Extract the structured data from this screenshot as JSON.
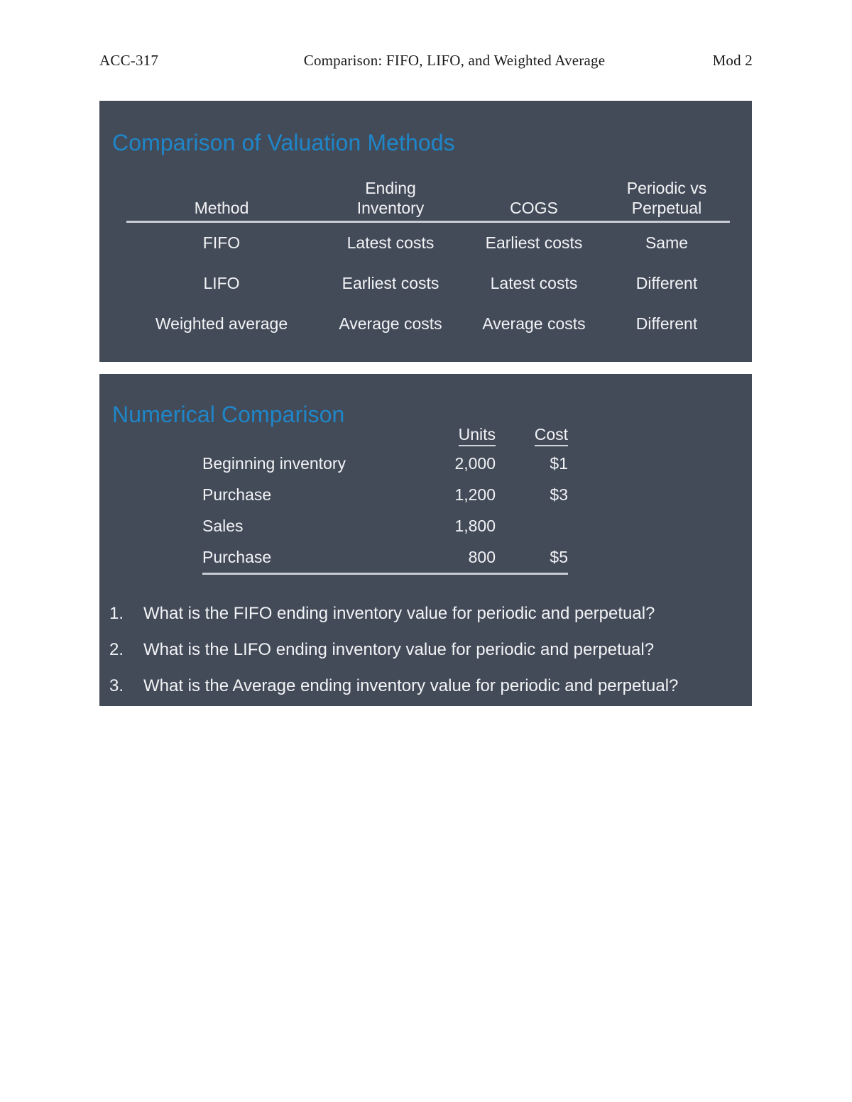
{
  "page_header": {
    "course_code": "ACC-317",
    "title": "Comparison: FIFO, LIFO, and Weighted Average",
    "module": "Mod 2"
  },
  "theme": {
    "slide_background": "#434b59",
    "accent_blue": "#1f86c8",
    "body_text": "#f2f3f5",
    "rule_color": "#c9ccd2",
    "page_background": "#ffffff"
  },
  "slide_valuation": {
    "title": "Comparison of Valuation Methods",
    "table": {
      "headers": {
        "method": "Method",
        "ending_inventory_line1": "Ending",
        "ending_inventory_line2": "Inventory",
        "cogs": "COGS",
        "periodic_line1": "Periodic vs",
        "periodic_line2": "Perpetual"
      },
      "rows": [
        {
          "method": "FIFO",
          "ending_inventory": "Latest costs",
          "cogs": "Earliest costs",
          "periodic_vs_perpetual": "Same"
        },
        {
          "method": "LIFO",
          "ending_inventory": "Earliest costs",
          "cogs": "Latest costs",
          "periodic_vs_perpetual": "Different"
        },
        {
          "method": "Weighted average",
          "ending_inventory": "Average costs",
          "cogs": "Average costs",
          "periodic_vs_perpetual": "Different"
        }
      ]
    }
  },
  "slide_numerical": {
    "title": "Numerical Comparison",
    "table": {
      "headers": {
        "label": "",
        "units": "Units",
        "cost": "Cost"
      },
      "rows": [
        {
          "label": "Beginning inventory",
          "units": "2,000",
          "cost": "$1"
        },
        {
          "label": "Purchase",
          "units": "1,200",
          "cost": "$3"
        },
        {
          "label": "Sales",
          "units": "1,800",
          "cost": ""
        },
        {
          "label": "Purchase",
          "units": "800",
          "cost": "$5"
        }
      ]
    },
    "questions": [
      {
        "number": "1.",
        "text": "What is the FIFO ending inventory value for periodic and perpetual?"
      },
      {
        "number": "2.",
        "text": "What is the LIFO ending inventory value for periodic and perpetual?"
      },
      {
        "number": "3.",
        "text": "What is the Average ending inventory value for periodic and perpetual?"
      }
    ]
  }
}
